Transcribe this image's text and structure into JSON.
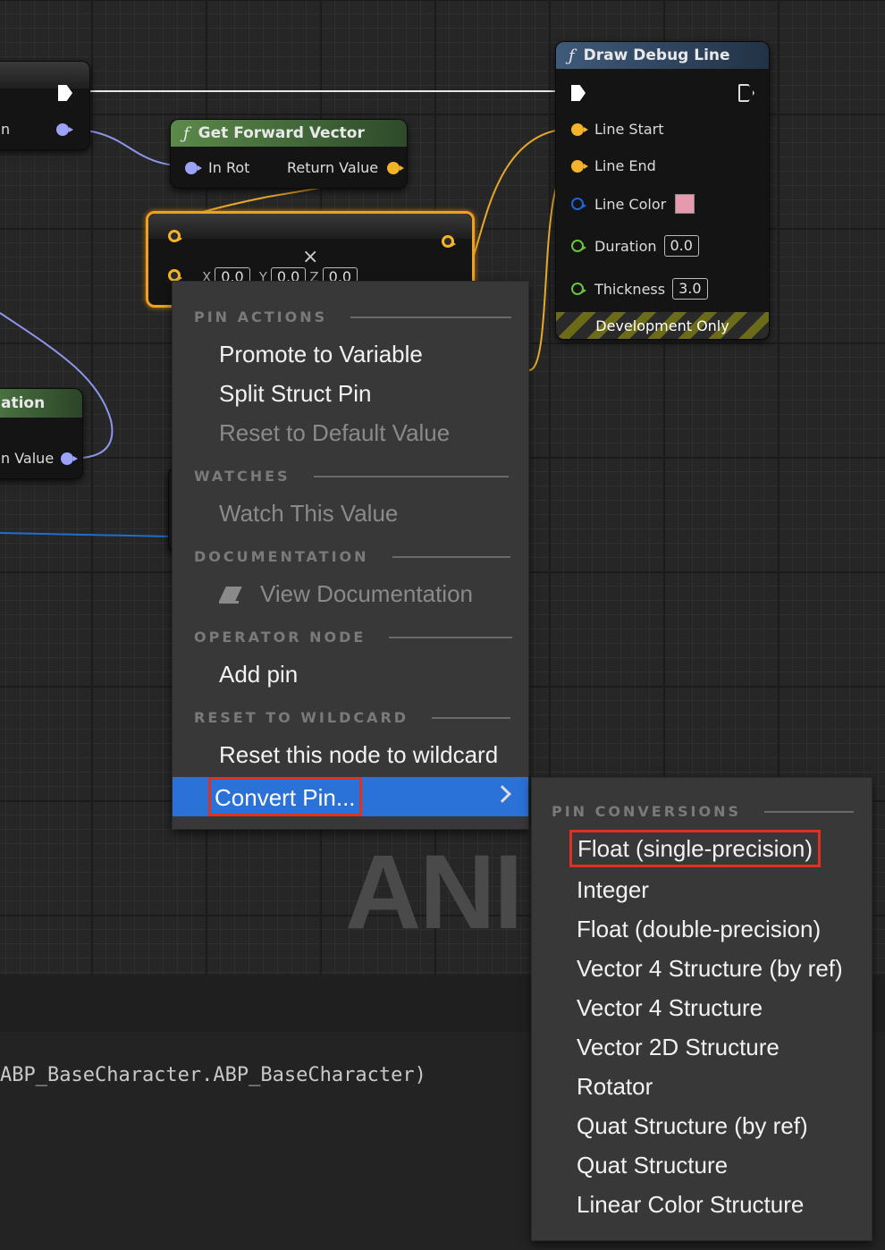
{
  "nodes": {
    "left_top": {
      "pin_fragment": "n"
    },
    "get_forward_vector": {
      "title": "Get Forward Vector",
      "input": "In Rot",
      "output": "Return Value"
    },
    "add_node": {
      "x_label": "X",
      "y_label": "Y",
      "z_label": "Z",
      "x_val": "0.0",
      "y_val": "0.0",
      "z_val": "0.0",
      "close": "×",
      "add_pin_fragment": "Add pin"
    },
    "left_mid": {
      "title_fragment": "ation",
      "pin_fragment": "n Value"
    },
    "draw_debug_line": {
      "title": "Draw Debug Line",
      "pins": {
        "line_start": "Line Start",
        "line_end": "Line End",
        "line_color": "Line Color",
        "duration": "Duration",
        "thickness": "Thickness"
      },
      "duration_value": "0.0",
      "thickness_value": "3.0",
      "line_color_hex": "#e59ab0",
      "footer": "Development Only"
    }
  },
  "background_text": "ANI",
  "log_text": "ABP_BaseCharacter.ABP_BaseCharacter)",
  "context_menu": {
    "sections": {
      "pin_actions": "PIN ACTIONS",
      "watches": "WATCHES",
      "documentation": "DOCUMENTATION",
      "operator_node": "OPERATOR NODE",
      "reset_to_wildcard": "RESET TO WILDCARD"
    },
    "items": {
      "promote": "Promote to Variable",
      "split": "Split Struct Pin",
      "reset_default": "Reset to Default Value",
      "watch": "Watch This Value",
      "view_doc": "View Documentation",
      "add_pin": "Add pin",
      "reset_wildcard": "Reset this node to wildcard",
      "convert_pin": "Convert Pin..."
    }
  },
  "sub_menu": {
    "header": "PIN CONVERSIONS",
    "items": [
      "Float (single-precision)",
      "Integer",
      "Float (double-precision)",
      "Vector 4 Structure (by ref)",
      "Vector 4 Structure",
      "Vector 2D Structure",
      "Rotator",
      "Quat Structure (by ref)",
      "Quat Structure",
      "Linear Color Structure"
    ]
  },
  "colors": {
    "accent_selection": "#2a72d8",
    "highlight_box": "#e03020",
    "exec_pin": "#ffffff",
    "vector_pin": "#f3b42a",
    "rotator_pin": "#9aa3f7",
    "float_pin": "#6ac53b"
  }
}
